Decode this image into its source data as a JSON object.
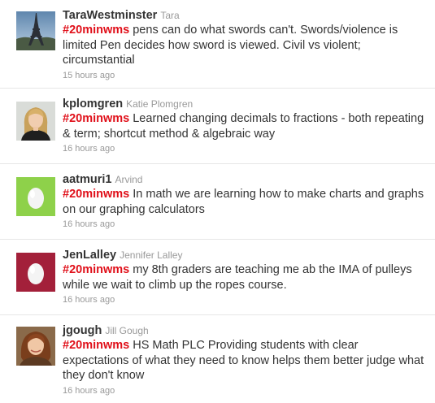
{
  "tweets": [
    {
      "screen_name": "TaraWestminster",
      "full_name": "Tara",
      "hashtag": "#20minwms",
      "text": " pens can do what swords can't. Swords/violence is limited Pen decides how sword is viewed. Civil vs violent; circumstantial",
      "time": "15 hours ago",
      "avatar": "eiffel-tower-photo"
    },
    {
      "screen_name": "kplomgren",
      "full_name": "Katie Plomgren",
      "hashtag": "#20minwms",
      "text": " Learned changing decimals to fractions - both repeating & term; shortcut method & algebraic way",
      "time": "16 hours ago",
      "avatar": "portrait-photo-blonde"
    },
    {
      "screen_name": "aatmuri1",
      "full_name": "Arvind",
      "hashtag": "#20minwms",
      "text": " In math we are learning how to make charts and graphs on our graphing calculators",
      "time": "16 hours ago",
      "avatar": "default-egg-avatar",
      "avatar_color": "#8ed14a"
    },
    {
      "screen_name": "JenLalley",
      "full_name": "Jennifer Lalley",
      "hashtag": "#20minwms",
      "text": " my 8th graders are teaching me ab the IMA of pulleys while we wait to climb up the ropes course.",
      "time": "16 hours ago",
      "avatar": "default-egg-avatar",
      "avatar_color": "#a3203a"
    },
    {
      "screen_name": "jgough",
      "full_name": "Jill Gough",
      "hashtag": "#20minwms",
      "text": " HS Math PLC Providing students with clear expectations of what they need to know helps them better judge what they don't know",
      "time": "16 hours ago",
      "avatar": "portrait-photo-brunette"
    }
  ],
  "colors": {
    "hashtag": "#e0101a",
    "screen_name": "#333333",
    "meta": "#999999",
    "divider": "#e6e6e6"
  }
}
